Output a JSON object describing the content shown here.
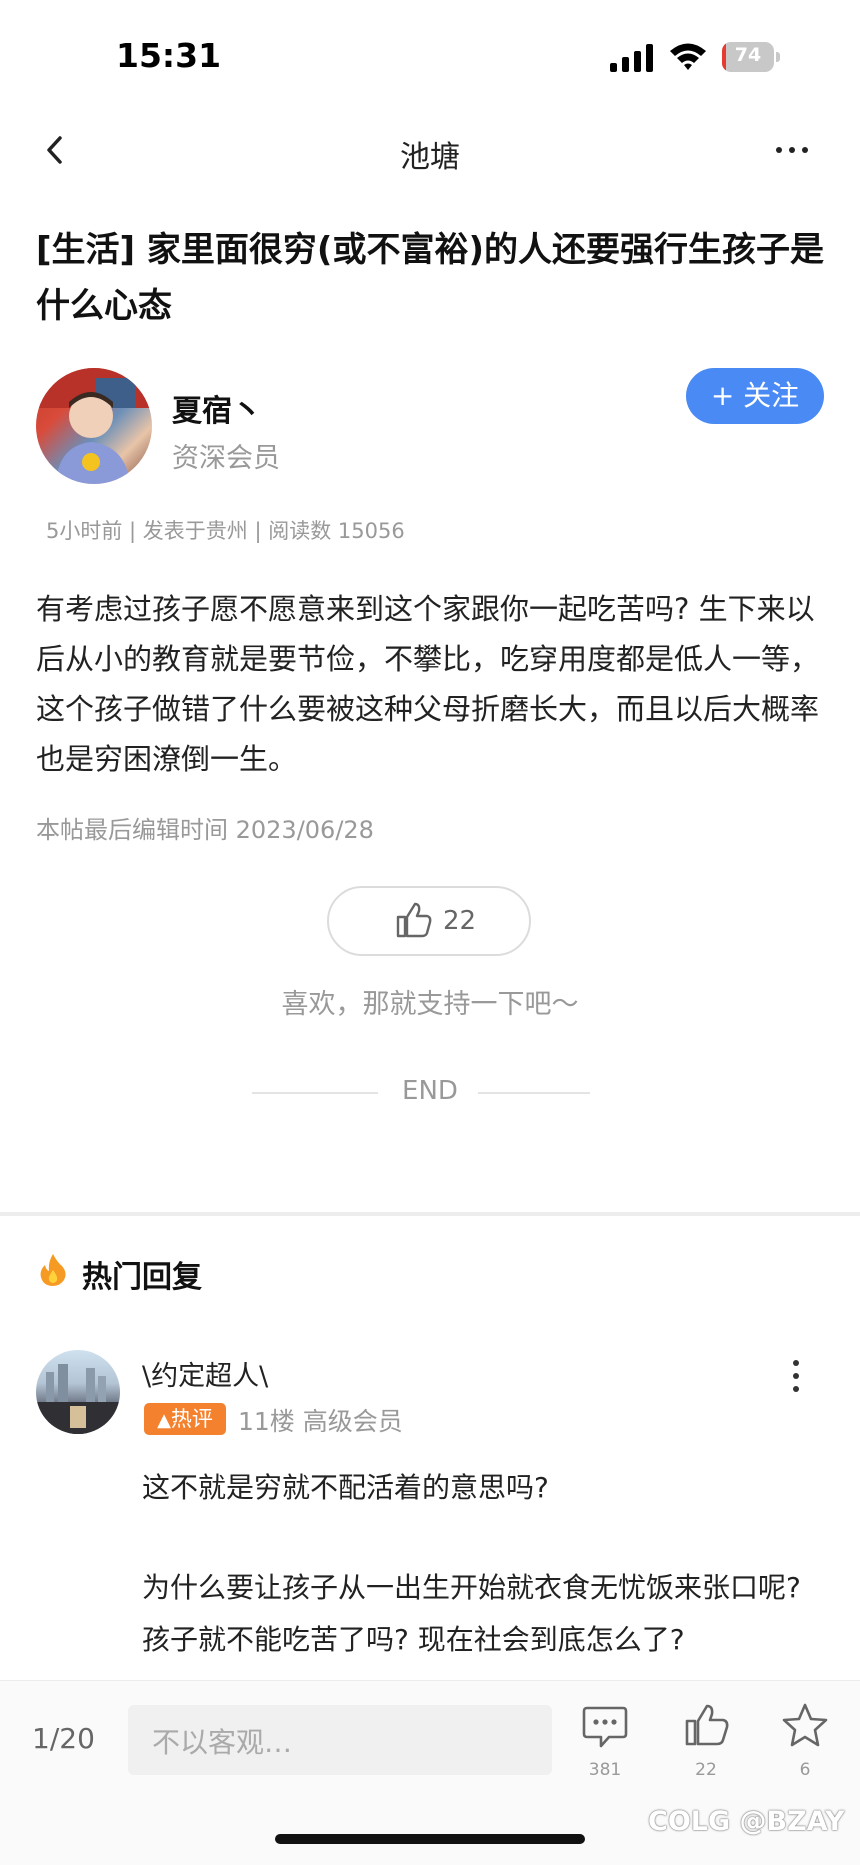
{
  "status_bar": {
    "time": "15:31",
    "battery": "74"
  },
  "nav": {
    "title": "池塘"
  },
  "post": {
    "title": "[生活] 家里面很穷(或不富裕)的人还要强行生孩子是什么心态",
    "author": "夏宿丶",
    "author_rank": "资深会员",
    "follow_label": "+ 关注",
    "meta": "5小时前 | 发表于贵州 | 阅读数 15056",
    "body": "有考虑过孩子愿不愿意来到这个家跟你一起吃苦吗? 生下来以后从小的教育就是要节俭，不攀比，吃穿用度都是低人一等，这个孩子做错了什么要被这种父母折磨长大，而且以后大概率也是穷困潦倒一生。",
    "edit_time": "本帖最后编辑时间 2023/06/28",
    "like_count": "22",
    "support_text": "喜欢，那就支持一下吧～",
    "end_label": "END"
  },
  "hot_replies": {
    "title": "热门回复",
    "items": [
      {
        "author": "\\约定超人\\",
        "badge": "热评",
        "floor_info": "11楼 高级会员",
        "line1": "这不就是穷就不配活着的意思吗?",
        "line2": "为什么要让孩子从一出生开始就衣食无忧饭来张口呢? 孩子就不能吃苦了吗? 现在社会到底怎么了?"
      }
    ]
  },
  "bottom_bar": {
    "page": "1/20",
    "input_placeholder": "不以客观…",
    "comment_count": "381",
    "like_count": "22",
    "star_count": "6"
  },
  "watermark": "COLG @BZAY",
  "colors": {
    "accent": "#4a8af4",
    "hot": "#f4812e",
    "fire": "#f59a23"
  },
  "icons": [
    "back-icon",
    "more-icon",
    "thumb-up-icon",
    "fire-icon",
    "comment-icon",
    "star-icon"
  ]
}
